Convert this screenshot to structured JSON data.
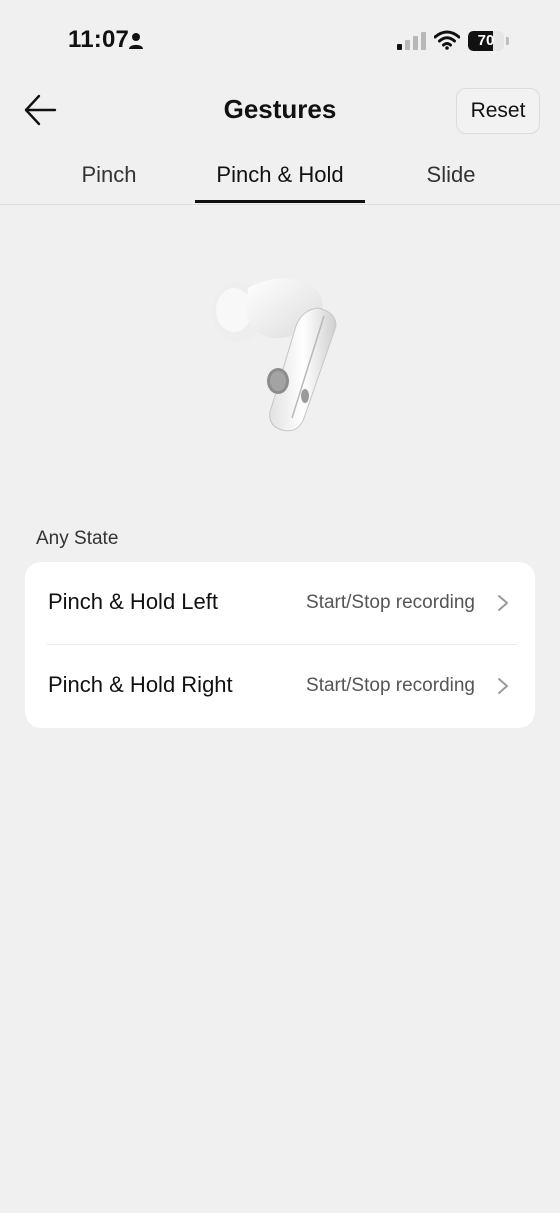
{
  "status_bar": {
    "time": "11:07",
    "battery_level": "70",
    "battery_fraction": 0.7,
    "signal_icon": "cellular-signal-icon",
    "wifi_icon": "wifi-icon",
    "person_icon": "person-icon"
  },
  "header": {
    "title": "Gestures",
    "back_icon": "arrow-left-icon",
    "reset_label": "Reset"
  },
  "tabs": [
    {
      "label": "Pinch",
      "active": false
    },
    {
      "label": "Pinch & Hold",
      "active": true
    },
    {
      "label": "Slide",
      "active": false
    }
  ],
  "section": {
    "label": "Any State"
  },
  "rows": [
    {
      "title": "Pinch & Hold Left",
      "value": "Start/Stop recording",
      "icon": "chevron-right-icon"
    },
    {
      "title": "Pinch & Hold Right",
      "value": "Start/Stop recording",
      "icon": "chevron-right-icon"
    }
  ],
  "colors": {
    "background": "#f0f0f0",
    "card": "#ffffff",
    "text": "#111111",
    "secondary_text": "#555555",
    "tab_indicator": "#111111"
  }
}
